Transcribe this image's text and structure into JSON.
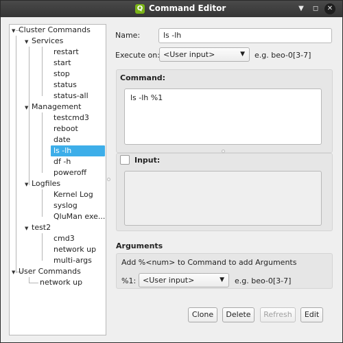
{
  "window": {
    "title": "Command Editor",
    "app_icon": "Q"
  },
  "tree": {
    "root_label": "Cluster Commands",
    "groups": [
      {
        "label": "Services",
        "items": [
          "restart",
          "start",
          "stop",
          "status",
          "status-all"
        ]
      },
      {
        "label": "Management",
        "items": [
          "testcmd3",
          "reboot",
          "date",
          "ls -lh",
          "df -h",
          "poweroff"
        ]
      },
      {
        "label": "Logfiles",
        "items": [
          "Kernel Log",
          "syslog",
          "QluMan exe..."
        ]
      },
      {
        "label": "test2",
        "items": [
          "cmd3",
          "network up",
          "multi-args"
        ]
      }
    ],
    "user_root_label": "User Commands",
    "user_items": [
      "network up"
    ],
    "selected": "ls -lh"
  },
  "form": {
    "name_label": "Name:",
    "name_value": "ls -lh",
    "execute_label": "Execute on:",
    "execute_value": "<User input>",
    "execute_hint": "e.g. beo-0[3-7]",
    "command_title": "Command:",
    "command_value": "ls -lh %1",
    "input_label": "Input:",
    "input_value": ""
  },
  "arguments": {
    "title": "Arguments",
    "hint": "Add %<num> to Command to add Arguments",
    "arg_label": "%1:",
    "arg_value": "<User input>",
    "arg_hint": "e.g. beo-0[3-7]"
  },
  "buttons": {
    "clone": "Clone",
    "delete": "Delete",
    "refresh": "Refresh",
    "edit": "Edit"
  },
  "colors": {
    "selection": "#3daee9",
    "titlebar": "#3a3a3a",
    "app_icon": "#7ab317"
  }
}
